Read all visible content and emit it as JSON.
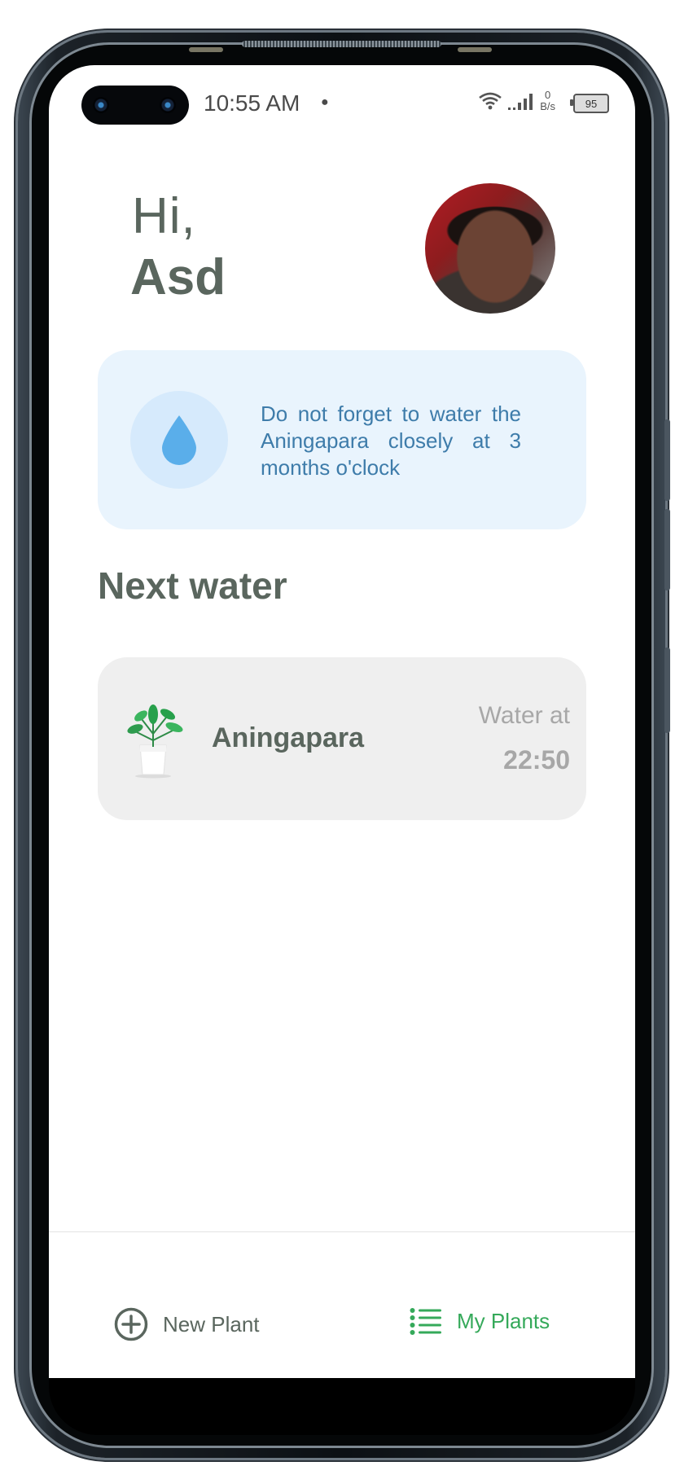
{
  "status_bar": {
    "time": "10:55 AM",
    "net_speed_value": "0",
    "net_speed_unit": "B/s",
    "battery": "95"
  },
  "greeting": {
    "hi": "Hi,",
    "name": "Asd"
  },
  "reminder": {
    "icon": "water-drop-icon",
    "text": "Do not forget to water the Aningapara closely at 3 months o'clock"
  },
  "next_water": {
    "title": "Next water",
    "plants": [
      {
        "name": "Aningapara",
        "water_label": "Water at",
        "water_time": "22:50",
        "icon": "potted-plant-icon"
      }
    ]
  },
  "bottom_nav": {
    "items": [
      {
        "label": "New Plant",
        "icon": "plus-circle-icon",
        "active": false
      },
      {
        "label": "My Plants",
        "icon": "list-icon",
        "active": true
      }
    ]
  },
  "colors": {
    "text_dark": "#5a665e",
    "accent_green": "#35a95a",
    "reminder_bg": "#e9f4fd",
    "reminder_text": "#3e7caa",
    "card_bg": "#efefef"
  }
}
